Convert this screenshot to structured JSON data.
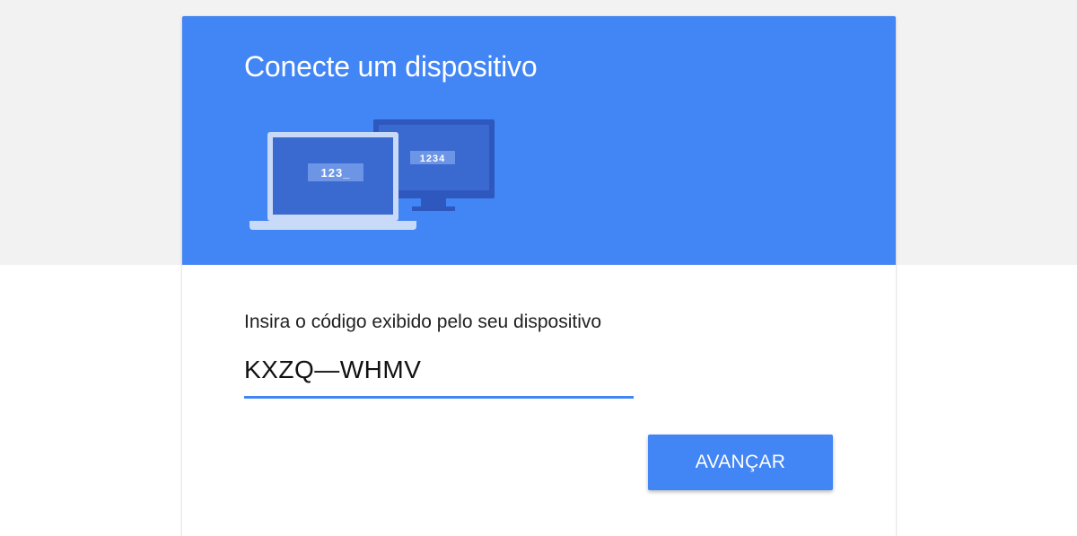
{
  "header": {
    "title": "Conecte um dispositivo",
    "background_color": "#4285f4"
  },
  "illustration": {
    "laptop_code": "123_",
    "tv_code": "1234"
  },
  "form": {
    "prompt": "Insira o código exibido pelo seu dispositivo",
    "code_value": "KXZQ—WHMV",
    "underline_color": "#4285f4"
  },
  "actions": {
    "next_label": "AVANÇAR"
  }
}
